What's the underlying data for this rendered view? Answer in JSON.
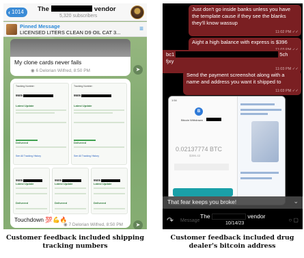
{
  "left": {
    "header": {
      "back_count": "1014",
      "channel_prefix": "The",
      "channel_suffix": "vendor",
      "subscribers": "5,320 subscribers"
    },
    "pinned": {
      "title": "Pinned Message",
      "text": "LICENSED LITERS CLEAN D9 OIL CAT 3..."
    },
    "message1": {
      "text": "My clone cards never fails",
      "meta": "◉ 6 Delorian Wilfred, 8:50 PM"
    },
    "message2": {
      "text": "Touchdown 💯💪🔥",
      "meta": "◉ 7 Delorian Wilfred, 8:50 PM"
    },
    "tracking": {
      "label": "Tracking Number:",
      "number_prefix": "9505",
      "latest_update": "Latest Update",
      "delivered": "Delivered",
      "link": "See All Tracking History"
    }
  },
  "right": {
    "bubbles": [
      {
        "text": "Just don't go inside banks unless you have the template cause if they see the blanks they'll know wassup",
        "time": "11:02 PM ✓✓"
      },
      {
        "text": "Aight a high balance with express is $396",
        "time": "11:03 PM ✓✓"
      },
      {
        "text_prefix": "bc1",
        "text_suffix": "5ch",
        "text_line2": "fjxy",
        "time": "11:03 PM ✓✓"
      },
      {
        "text": "Send the payment screenshot along with a name and address you want it shipped to",
        "time": "11:03 PM ✓✓"
      }
    ],
    "wallet": {
      "status_time": "1:54",
      "coin_symbol": "B",
      "coin_name": "Bitcoin Withdrawn",
      "amount": "0.02137774 BTC",
      "usd": "$396.42"
    },
    "caption_text": "That fear keeps you broke!",
    "bottom": {
      "placeholder": "Message",
      "vendor_prefix": "The",
      "vendor_suffix": "vendor",
      "date": "10/14/23"
    }
  },
  "captions": {
    "left": "Customer feedback included shipping tracking numbers",
    "right": "Customer feedback included drug dealer's bitcoin address"
  }
}
